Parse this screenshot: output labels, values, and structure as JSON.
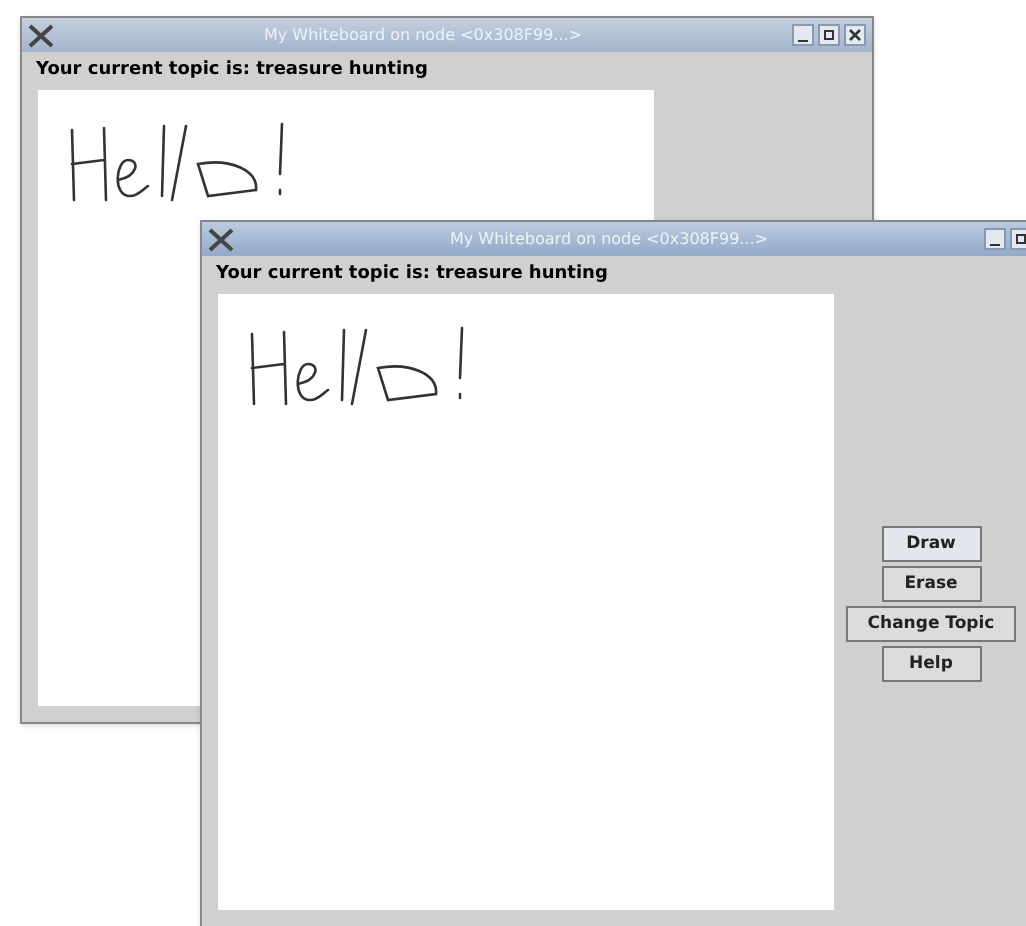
{
  "windows": [
    {
      "title": "My Whiteboard on node <0x308F99...>",
      "active": false,
      "topic": "Your current topic is: treasure hunting",
      "title_buttons": [
        {
          "kind": "minimize"
        },
        {
          "kind": "maximize"
        },
        {
          "kind": "close"
        }
      ]
    },
    {
      "title": "My Whiteboard on node <0x308F99...>",
      "active": true,
      "topic": "Your current topic is: treasure hunting",
      "title_buttons": [
        {
          "kind": "minimize"
        },
        {
          "kind": "maximize"
        }
      ],
      "buttons": [
        {
          "label": "Draw",
          "selected": true
        },
        {
          "label": "Erase",
          "selected": false
        },
        {
          "label": "Change Topic",
          "selected": false
        },
        {
          "label": "Help",
          "selected": false
        }
      ]
    }
  ]
}
